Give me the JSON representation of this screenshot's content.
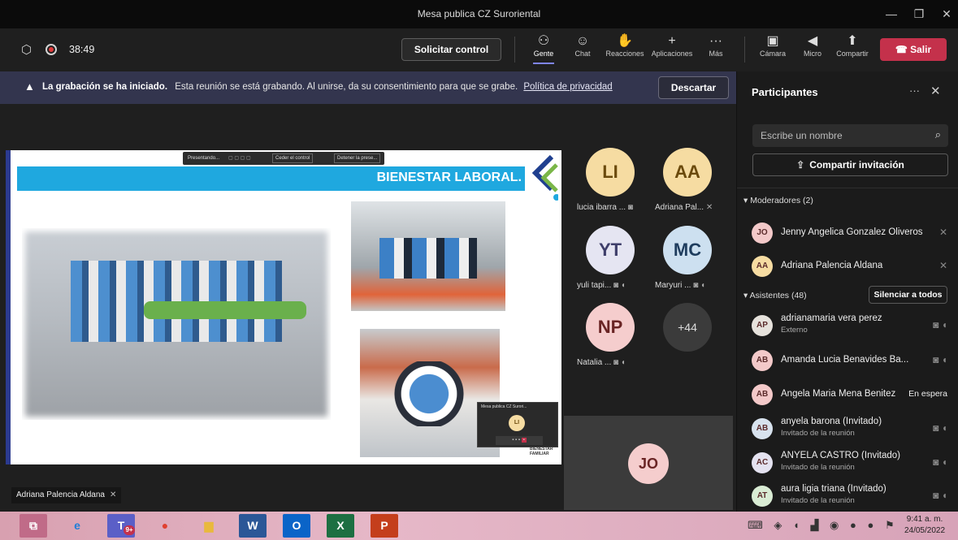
{
  "window": {
    "title": "Mesa publica CZ Suroriental"
  },
  "toolbar": {
    "timer": "38:49",
    "request_control": "Solicitar control",
    "items": [
      {
        "label": "Gente",
        "icon": "people-icon"
      },
      {
        "label": "Chat",
        "icon": "chat-icon"
      },
      {
        "label": "Reacciones",
        "icon": "reactions-icon"
      },
      {
        "label": "Aplicaciones",
        "icon": "plus-icon"
      },
      {
        "label": "Más",
        "icon": "more-icon"
      }
    ],
    "media": [
      {
        "label": "Cámara",
        "icon": "camera-off-icon"
      },
      {
        "label": "Micro",
        "icon": "mic-off-icon"
      },
      {
        "label": "Compartir",
        "icon": "share-icon"
      }
    ],
    "leave": "Salir"
  },
  "banner": {
    "bold": "La grabación se ha iniciado.",
    "text": "Esta reunión se está grabando. Al unirse, da su consentimiento para que se grabe.",
    "link": "Política de privacidad",
    "dismiss": "Descartar"
  },
  "slide": {
    "presenter_bar": "Presentando...",
    "give_control": "Ceder el control",
    "stop": "Detener la prese...",
    "heading": "BIENESTAR LABORAL.",
    "logo_caption": "BIENESTAR FAMILIAR",
    "mini_window_title": "Mesa publica CZ Surori...",
    "mini_avatar": "LI"
  },
  "presenter_label": "Adriana Palencia Aldana",
  "video_tiles": [
    {
      "initials": "LI",
      "name": "lucia ibarra ...",
      "color": "#f6dca2",
      "text": "#6b4a0c"
    },
    {
      "initials": "AA",
      "name": "Adriana Pal...",
      "color": "#f6dca2",
      "text": "#6b4a0c"
    },
    {
      "initials": "YT",
      "name": "yuli tapi...",
      "color": "#e5e5f2",
      "text": "#3e3e6a"
    },
    {
      "initials": "MC",
      "name": "Maryuri ...",
      "color": "#cde0f0",
      "text": "#1f3d5e"
    },
    {
      "initials": "NP",
      "name": "Natalia ...",
      "color": "#f5cdcd",
      "text": "#6a2525"
    },
    {
      "initials": "+44",
      "name": "",
      "color": "#3b3b3b",
      "text": "#ddd"
    }
  ],
  "self_tile": {
    "initials": "JO"
  },
  "panel": {
    "title": "Participantes",
    "search_placeholder": "Escribe un nombre",
    "share_invite": "Compartir invitación",
    "moderators_label": "Moderadores (2)",
    "moderators": [
      {
        "initials": "JO",
        "name": "Jenny Angelica Gonzalez Oliveros",
        "color": "#f3c9c9"
      },
      {
        "initials": "AA",
        "name": "Adriana Palencia Aldana",
        "color": "#f6dca2"
      }
    ],
    "attendees_label": "Asistentes (48)",
    "mute_all": "Silenciar a todos",
    "attendees": [
      {
        "initials": "AP",
        "name": "adrianamaria vera perez",
        "sub": "Externo",
        "color": "#e6e2dc"
      },
      {
        "initials": "AB",
        "name": "Amanda Lucia Benavides Ba...",
        "sub": "",
        "color": "#f3c9c9"
      },
      {
        "initials": "AB",
        "name": "Angela Maria Mena Benitez",
        "sub": "",
        "status": "En espera",
        "color": "#f3c9c9"
      },
      {
        "initials": "AB",
        "name": "anyela barona (Invitado)",
        "sub": "Invitado de la reunión",
        "color": "#d7e2ee"
      },
      {
        "initials": "AC",
        "name": "ANYELA CASTRO (Invitado)",
        "sub": "Invitado de la reunión",
        "color": "#e4e2f0"
      },
      {
        "initials": "AT",
        "name": "aura ligia triana (Invitado)",
        "sub": "Invitado de la reunión",
        "color": "#d9ecd4"
      }
    ]
  },
  "taskbar": {
    "time": "9:41 a. m.",
    "date": "24/05/2022",
    "apps": [
      {
        "name": "taskview-icon",
        "glyph": "⧉",
        "bg": "#c06b88",
        "fg": "#fff"
      },
      {
        "name": "edge-icon",
        "glyph": "e",
        "bg": "transparent",
        "fg": "#1f7ed8"
      },
      {
        "name": "teams-icon",
        "glyph": "T",
        "bg": "#5b5fc7",
        "fg": "#fff"
      },
      {
        "name": "chrome-icon",
        "glyph": "●",
        "bg": "transparent",
        "fg": "#e0402f"
      },
      {
        "name": "explorer-icon",
        "glyph": "▆",
        "bg": "transparent",
        "fg": "#e9b93c"
      },
      {
        "name": "word-icon",
        "glyph": "W",
        "bg": "#2b5797",
        "fg": "#fff"
      },
      {
        "name": "outlook-icon",
        "glyph": "O",
        "bg": "#0a64c8",
        "fg": "#fff"
      },
      {
        "name": "excel-icon",
        "glyph": "X",
        "bg": "#1d6f42",
        "fg": "#fff"
      },
      {
        "name": "powerpoint-icon",
        "glyph": "P",
        "bg": "#c43e1c",
        "fg": "#fff"
      }
    ],
    "teams_badge": "9+"
  }
}
